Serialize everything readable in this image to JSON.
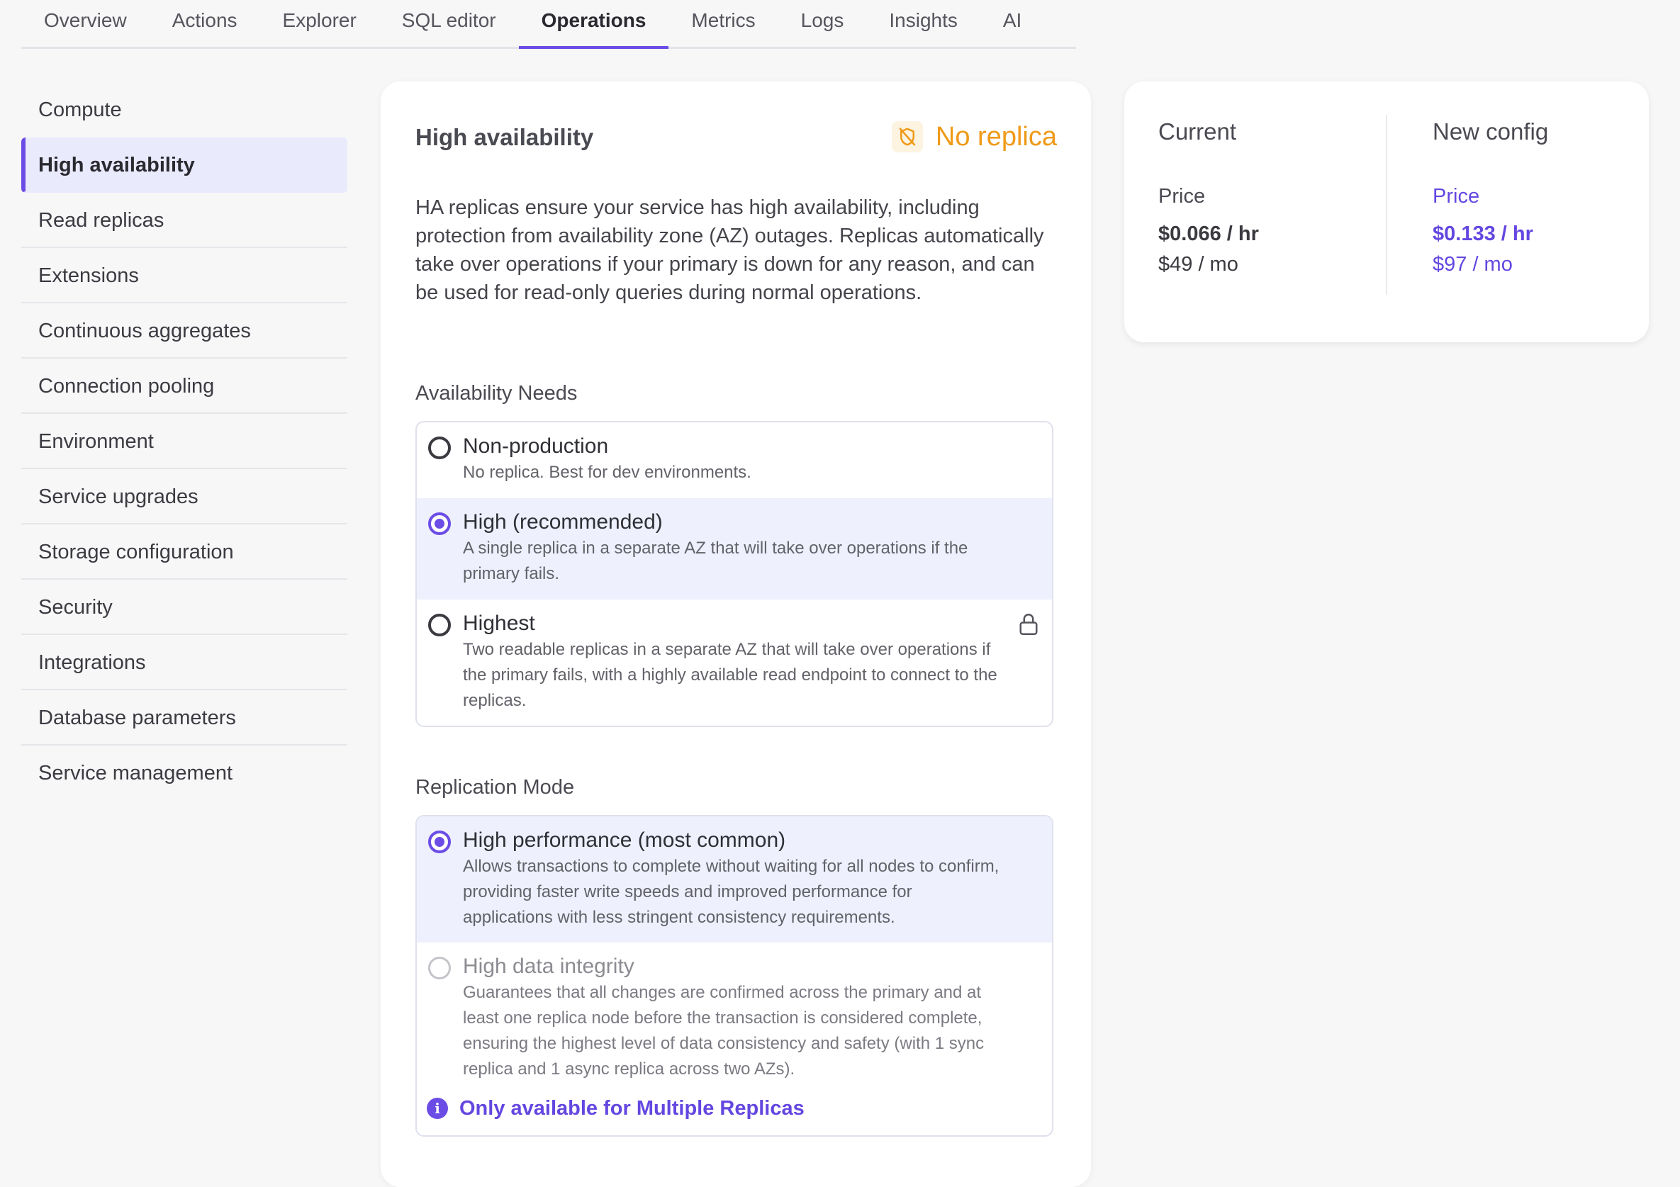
{
  "tabs": [
    "Overview",
    "Actions",
    "Explorer",
    "SQL editor",
    "Operations",
    "Metrics",
    "Logs",
    "Insights",
    "AI"
  ],
  "active_tab": "Operations",
  "sidebar": {
    "items": [
      "Compute",
      "High availability",
      "Read replicas",
      "Extensions",
      "Continuous aggregates",
      "Connection pooling",
      "Environment",
      "Service upgrades",
      "Storage configuration",
      "Security",
      "Integrations",
      "Database parameters",
      "Service management"
    ],
    "active": "High availability"
  },
  "main": {
    "title": "High availability",
    "status": {
      "text": "No replica",
      "icon": "shield-off-icon",
      "color": "#ef9a17"
    },
    "description": "HA replicas ensure your service has high availability, including protection from availability zone (AZ) outages. Replicas automatically take over operations if your primary is down for any reason, and can be used for read-only queries during normal operations.",
    "availability": {
      "label": "Availability Needs",
      "options": [
        {
          "title": "Non-production",
          "subtitle": "No replica. Best for dev environments.",
          "selected": false
        },
        {
          "title": "High (recommended)",
          "subtitle": "A single replica in a separate AZ that will take over operations if the primary fails.",
          "selected": true
        },
        {
          "title": "Highest",
          "subtitle": "Two readable replicas in a separate AZ that will take over operations if the primary fails, with a highly available read endpoint to connect to the replicas.",
          "selected": false,
          "locked": true,
          "icon": "lock-icon"
        }
      ]
    },
    "replication": {
      "label": "Replication Mode",
      "options": [
        {
          "title": "High performance (most common)",
          "subtitle": "Allows transactions to complete without waiting for all nodes to confirm, providing faster write speeds and improved performance for applications with less stringent consistency requirements.",
          "selected": true
        },
        {
          "title": "High data integrity",
          "subtitle": "Guarantees that all changes are confirmed across the primary and at least one replica node before the transaction is considered complete, ensuring the highest level of data consistency and safety (with 1 sync replica and 1 async replica across two AZs).",
          "selected": false,
          "disabled": true
        }
      ],
      "note": "Only available for Multiple Replicas",
      "note_icon": "info-icon"
    }
  },
  "pricing": {
    "current": {
      "heading": "Current",
      "label": "Price",
      "hourly": "$0.066 / hr",
      "monthly": "$49 / mo"
    },
    "new_config": {
      "heading": "New config",
      "label": "Price",
      "hourly": "$0.133 / hr",
      "monthly": "$97 / mo"
    }
  },
  "colors": {
    "accent": "#6b4de6",
    "warning": "#ef9a17",
    "selected_bg": "#eef0fd"
  }
}
